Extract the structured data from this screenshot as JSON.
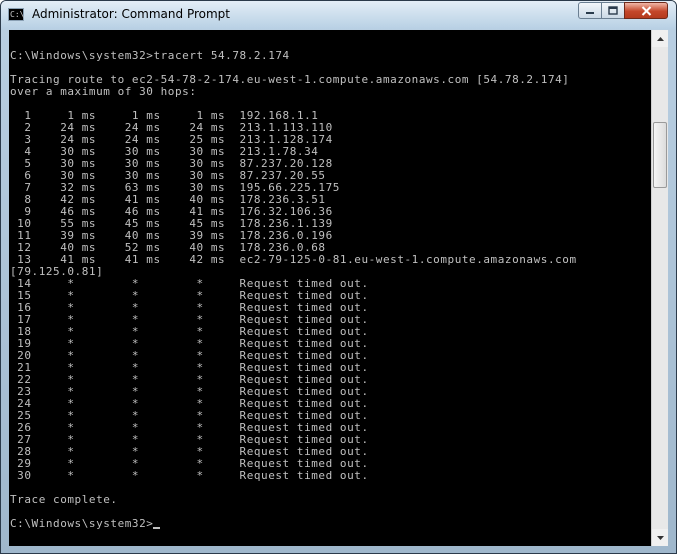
{
  "window": {
    "title": "Administrator: Command Prompt",
    "icon": "cmd-icon",
    "icon_text": "C:\\",
    "controls": [
      "minimize-icon",
      "maximize-icon",
      "close-icon"
    ]
  },
  "console": {
    "lines": [
      "",
      "C:\\Windows\\system32>tracert 54.78.2.174",
      "",
      "Tracing route to ec2-54-78-2-174.eu-west-1.compute.amazonaws.com [54.78.2.174]",
      "over a maximum of 30 hops:",
      "",
      "  1     1 ms     1 ms     1 ms  192.168.1.1",
      "  2    24 ms    24 ms    24 ms  213.1.113.110",
      "  3    24 ms    24 ms    25 ms  213.1.128.174",
      "  4    30 ms    30 ms    30 ms  213.1.78.34",
      "  5    30 ms    30 ms    30 ms  87.237.20.128",
      "  6    30 ms    30 ms    30 ms  87.237.20.55",
      "  7    32 ms    63 ms    30 ms  195.66.225.175",
      "  8    42 ms    41 ms    40 ms  178.236.3.51",
      "  9    46 ms    46 ms    41 ms  176.32.106.36",
      " 10    55 ms    45 ms    45 ms  178.236.1.139",
      " 11    39 ms    40 ms    39 ms  178.236.0.196",
      " 12    40 ms    52 ms    40 ms  178.236.0.68",
      " 13    41 ms    41 ms    42 ms  ec2-79-125-0-81.eu-west-1.compute.amazonaws.com",
      "[79.125.0.81]",
      " 14     *        *        *     Request timed out.",
      " 15     *        *        *     Request timed out.",
      " 16     *        *        *     Request timed out.",
      " 17     *        *        *     Request timed out.",
      " 18     *        *        *     Request timed out.",
      " 19     *        *        *     Request timed out.",
      " 20     *        *        *     Request timed out.",
      " 21     *        *        *     Request timed out.",
      " 22     *        *        *     Request timed out.",
      " 23     *        *        *     Request timed out.",
      " 24     *        *        *     Request timed out.",
      " 25     *        *        *     Request timed out.",
      " 26     *        *        *     Request timed out.",
      " 27     *        *        *     Request timed out.",
      " 28     *        *        *     Request timed out.",
      " 29     *        *        *     Request timed out.",
      " 30     *        *        *     Request timed out.",
      "",
      "Trace complete.",
      "",
      "C:\\Windows\\system32>"
    ],
    "colors": {
      "background": "#000000",
      "foreground": "#c0c0c0"
    }
  }
}
